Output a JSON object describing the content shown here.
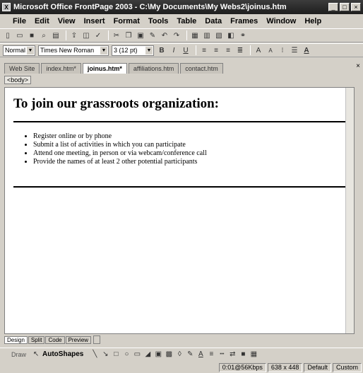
{
  "window": {
    "title": "Microsoft Office FrontPage 2003 - C:\\My Documents\\My Webs2\\joinus.htm",
    "app_icon": "frontpage-app-icon",
    "controls": [
      "minimize",
      "maximize",
      "close"
    ]
  },
  "menubar": {
    "items": [
      "File",
      "Edit",
      "View",
      "Insert",
      "Format",
      "Tools",
      "Table",
      "Data",
      "Frames",
      "Window",
      "Help"
    ]
  },
  "toolbar_standard": {
    "icons": [
      "new-icon",
      "open-icon",
      "save-icon",
      "search-icon",
      "print-icon",
      "publish-icon",
      "preview-icon",
      "spelling-icon",
      "cut-icon",
      "copy-icon",
      "paste-icon",
      "format-painter-icon",
      "undo-icon",
      "redo-icon",
      "insert-layer-icon",
      "table-icon",
      "picture-icon",
      "code-view-icon",
      "hyperlink-icon"
    ]
  },
  "toolbar_formatting": {
    "style": "Normal",
    "font": "Times New Roman",
    "size": "3 (12 pt)",
    "icons": [
      "bold-icon",
      "italic-icon",
      "underline-icon",
      "align-left-icon",
      "align-center-icon",
      "align-right-icon",
      "justify-icon",
      "increase-font-icon",
      "decrease-font-icon",
      "numbering-icon",
      "bullets-icon",
      "font-color-icon"
    ]
  },
  "page_tabs": {
    "items": [
      "Web Site",
      "index.htm*",
      "joinus.htm*",
      "affiliations.htm",
      "contact.htm"
    ],
    "active_index": 2
  },
  "tag_selector": "<body>",
  "document": {
    "heading": "To join our grassroots organization:",
    "bullets": [
      "Register online or by phone",
      "Submit a list of activities in which you can participate",
      "Attend one meeting, in person or via webcam/conference call",
      "Provide the names of at least 2 other potential participants"
    ]
  },
  "view_tabs": {
    "items": [
      "Design",
      "Split",
      "Code",
      "Preview"
    ],
    "active_index": 0
  },
  "drawing_toolbar": {
    "draw_label": "Draw",
    "autoshapes_label": "AutoShapes"
  },
  "statusbar": {
    "download_time": "0:01@56Kbps",
    "page_size": "638 x 448",
    "mode": "Default",
    "style": "Custom"
  }
}
